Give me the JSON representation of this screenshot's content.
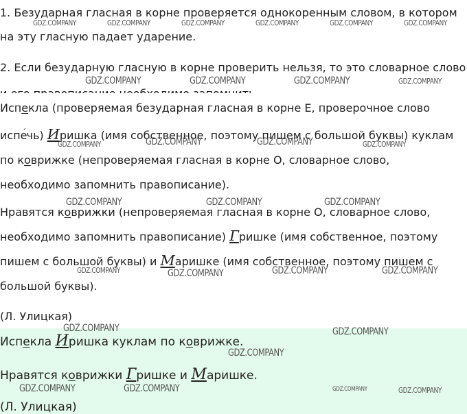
{
  "rules": {
    "rule1_line1": "1. Безударная гласная в корне проверяется однокоренным словом, в котором",
    "rule1_line2": "на эту гласную падает ударение.",
    "rule2_line1": "2. Если безударную гласную в корне проверить нельзя, то это словарное слово",
    "rule2_line2": "и его правописание необходимо запомнить."
  },
  "analysis": {
    "l1_pre": "Исп",
    "l1_v": "е",
    "l1_post": "кла (проверяемая безударная гласная в корне Е, проверочное слово",
    "l2_a": "испе",
    "l2_acc": "́",
    "l2_b": "чь) ",
    "l2_cap": "И",
    "l2_c": "ришка (имя собственное, поэтому пишем с большой буквы) куклам",
    "l3_pre": "по к",
    "l3_v": "о",
    "l3_post": "врижке (непроверяемая гласная в корне О, словарное слово,",
    "l4": "необходимо запомнить правописание).",
    "l5_pre": "Нравятся к",
    "l5_v": "о",
    "l5_post": "врижки (непроверяемая гласная в корне О, словарное слово,",
    "l6_a": "необходимо запомнить правописание) ",
    "l6_cap": "Г",
    "l6_b": "ришке (имя собственное, поэтому",
    "l7_a": "пишем с большой буквы) и ",
    "l7_cap": "М",
    "l7_b": "аришке (имя собственное, поэтому пишем с",
    "l8": "большой буквы).",
    "author": "(Л. Улицкая)"
  },
  "answer": {
    "l1_a": "Исп",
    "l1_v": "е",
    "l1_b": "кла ",
    "l1_cap": "И",
    "l1_c": "ришка куклам по к",
    "l1_v2": "о",
    "l1_d": "врижке.",
    "l2_a": "Нравятся к",
    "l2_v": "о",
    "l2_b": "врижки ",
    "l2_cap": "Г",
    "l2_c": "ришке и ",
    "l2_cap2": "М",
    "l2_d": "аришке.",
    "author": "(Л. Улицкая)"
  },
  "watermark": "GDZ.COMPANY",
  "colors": {
    "highlight": "#e3fbec",
    "text": "#222222"
  }
}
